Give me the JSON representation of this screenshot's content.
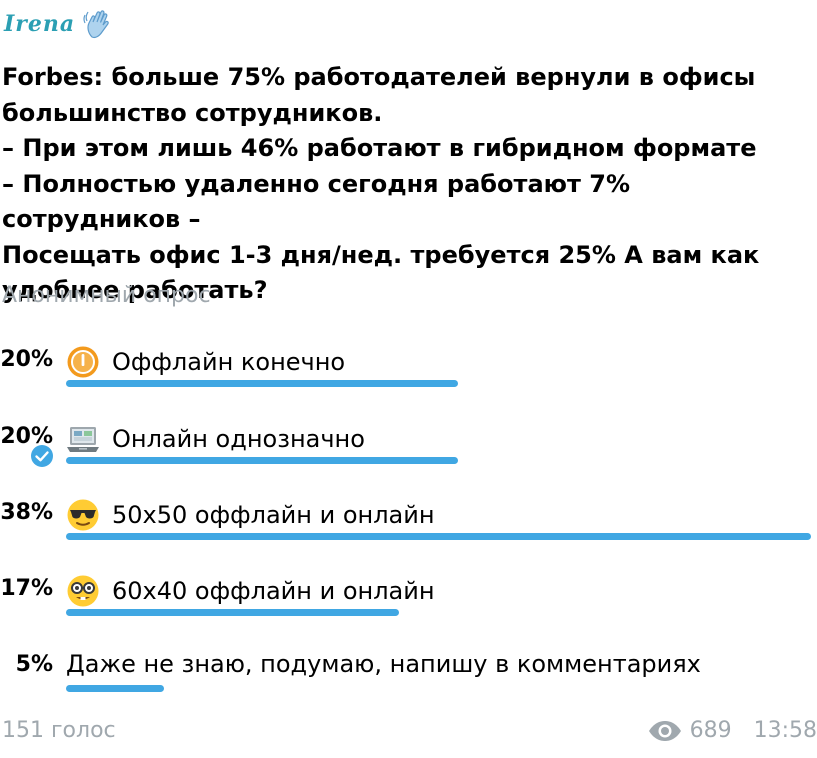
{
  "post": {
    "author": "Irena",
    "author_icon": "waving-hand-icon",
    "question": "Forbes: больше 75% работодателей вернули в офисы\nбольшинство сотрудников.\n– При этом лишь 46% работают в гибридном формате\n– Полностью удаленно сегодня работают 7% сотрудников –\nПосещать офис 1-3 дня/нед. требуется  25% А вам как\nудобнее работать?",
    "poll_type": "Анонимный опрос",
    "options": [
      {
        "percent": "20%",
        "fraction": 0.2,
        "text": "Оффлайн конечно",
        "icon": "orange-circle-icon",
        "voted": false
      },
      {
        "percent": "20%",
        "fraction": 0.2,
        "text": "Онлайн однозначно",
        "icon": "laptop-icon",
        "voted": true
      },
      {
        "percent": "38%",
        "fraction": 0.38,
        "text": "50х50 оффлайн и онлайн",
        "icon": "sunglasses-face-icon",
        "voted": false
      },
      {
        "percent": "17%",
        "fraction": 0.17,
        "text": "60х40 оффлайн и онлайн",
        "icon": "nerd-face-icon",
        "voted": false
      },
      {
        "percent": "5%",
        "fraction": 0.05,
        "text": "Даже не знаю, подумаю, напишу в комментариях",
        "icon": "",
        "voted": false
      }
    ],
    "total_votes": "151 голос",
    "views": "689",
    "time": "13:58"
  },
  "colors": {
    "accent": "#40a7e3",
    "muted_text": "#a0a8ae",
    "author": "#2b9fb3"
  }
}
